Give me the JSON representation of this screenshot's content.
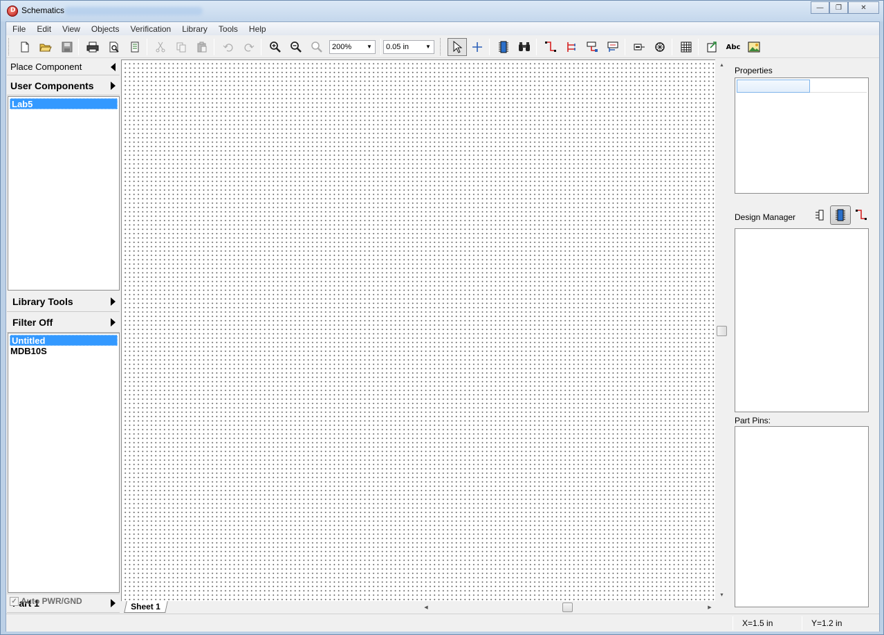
{
  "window": {
    "title": "Schematics",
    "minimize": "—",
    "restore": "❐",
    "close": "✕"
  },
  "menu": [
    "File",
    "Edit",
    "View",
    "Objects",
    "Verification",
    "Library",
    "Tools",
    "Help"
  ],
  "toolbar": {
    "zoom": "200%",
    "grid": "0.05 in",
    "abc_label": "Abc"
  },
  "left_panel": {
    "place_component": "Place Component",
    "user_components": "User Components",
    "user_list": [
      {
        "label": "Lab5",
        "selected": true
      }
    ],
    "library_tools": "Library Tools",
    "filter": "Filter Off",
    "component_list": [
      {
        "label": "Untitled",
        "selected": true
      },
      {
        "label": "MDB10S",
        "selected": false
      }
    ],
    "part": "Part 1",
    "auto_pwr_gnd": "Auto PWR/GND",
    "check_mark": "✓"
  },
  "canvas": {
    "sheet_tab": "Sheet 1"
  },
  "right_panel": {
    "properties": "Properties",
    "design_manager": "Design Manager",
    "part_pins": "Part Pins:"
  },
  "status": {
    "x": "X=1.5 in",
    "y": "Y=1.2 in"
  },
  "colors": {
    "selection": "#3399ff",
    "wire_red": "#d42020",
    "chip_blue": "#2a6fc9"
  }
}
